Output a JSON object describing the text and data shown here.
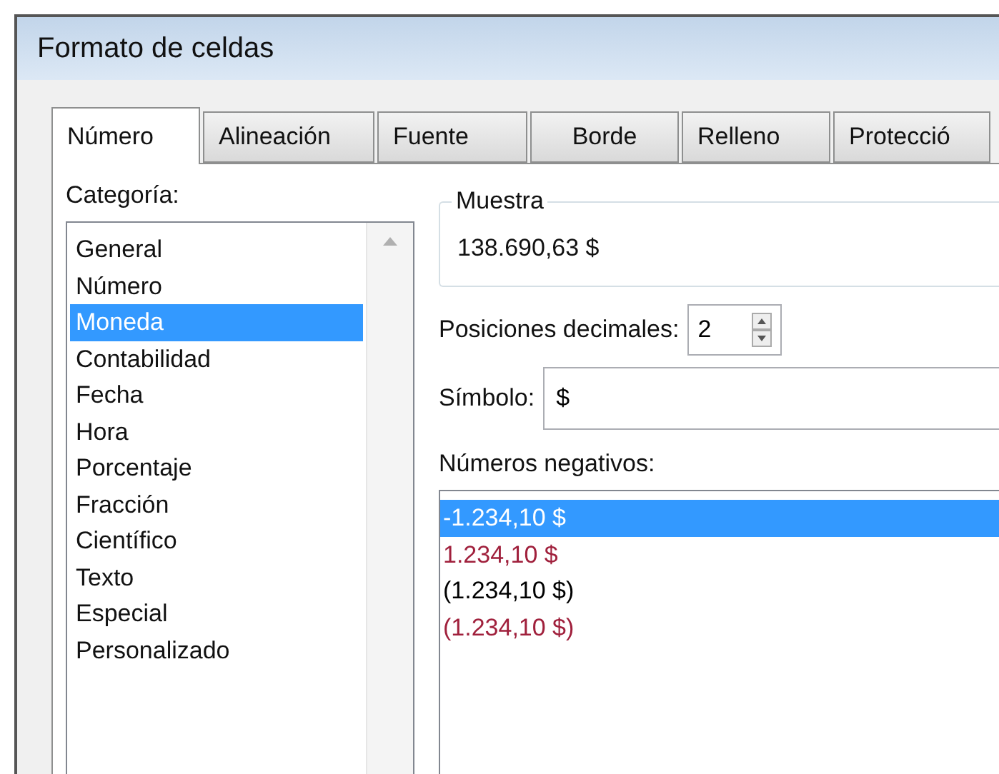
{
  "window": {
    "title": "Formato de celdas"
  },
  "tabs": [
    {
      "label": "Número",
      "selected": true
    },
    {
      "label": "Alineación",
      "selected": false
    },
    {
      "label": "Fuente",
      "selected": false
    },
    {
      "label": "Borde",
      "selected": false
    },
    {
      "label": "Relleno",
      "selected": false
    },
    {
      "label": "Protecció",
      "selected": false
    }
  ],
  "category": {
    "label": "Categoría:",
    "items": [
      {
        "label": "General",
        "selected": false
      },
      {
        "label": "Número",
        "selected": false
      },
      {
        "label": "Moneda",
        "selected": true
      },
      {
        "label": "Contabilidad",
        "selected": false
      },
      {
        "label": "Fecha",
        "selected": false
      },
      {
        "label": "Hora",
        "selected": false
      },
      {
        "label": "Porcentaje",
        "selected": false
      },
      {
        "label": "Fracción",
        "selected": false
      },
      {
        "label": "Científico",
        "selected": false
      },
      {
        "label": "Texto",
        "selected": false
      },
      {
        "label": "Especial",
        "selected": false
      },
      {
        "label": "Personalizado",
        "selected": false
      }
    ]
  },
  "sample": {
    "label": "Muestra",
    "value": "138.690,63 $"
  },
  "decimals": {
    "label": "Posiciones decimales:",
    "value": "2"
  },
  "symbol": {
    "label": "Símbolo:",
    "value": "$"
  },
  "negatives": {
    "label": "Números negativos:",
    "items": [
      {
        "label": "-1.234,10 $",
        "selected": true
      },
      {
        "label": "1.234,10 $",
        "selected": false,
        "color": "#a0203c"
      },
      {
        "label": "(1.234,10 $)",
        "selected": false,
        "color": "#000000"
      },
      {
        "label": "(1.234,10 $)",
        "selected": false,
        "color": "#a0203c"
      }
    ]
  }
}
